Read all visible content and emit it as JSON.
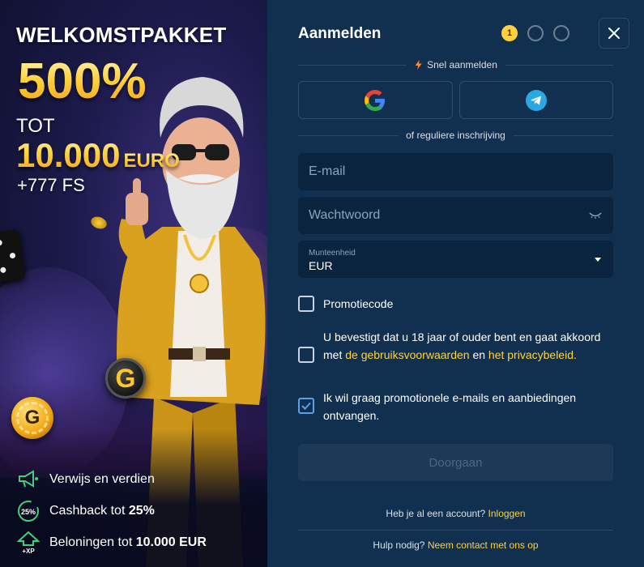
{
  "promo": {
    "title": "WELKOMSTPAKKET",
    "percent": "500%",
    "tot": "TOT",
    "amount": "10.000",
    "currency": "EURO",
    "free_spins": "+777 FS",
    "chip_letter": "G",
    "coin_letter": "G",
    "features": [
      {
        "icon": "megaphone-icon",
        "text": "Verwijs en verdien",
        "bold": ""
      },
      {
        "icon": "cashback-25-icon",
        "icon_text": "25%",
        "text": "Cashback tot ",
        "bold": "25%"
      },
      {
        "icon": "xp-arrow-icon",
        "icon_text": "+XP",
        "text": "Beloningen tot ",
        "bold": "10.000 EUR"
      }
    ]
  },
  "form": {
    "title": "Aanmelden",
    "step_active": "1",
    "quick_label": "Snel aanmelden",
    "or_label": "of reguliere inschrijving",
    "email_placeholder": "E-mail",
    "password_placeholder": "Wachtwoord",
    "currency_label": "Munteenheid",
    "currency_value": "EUR",
    "promo_code_label": "Promotiecode",
    "terms_text_1": "U bevestigt dat u 18 jaar of ouder bent en gaat akkoord met ",
    "terms_link_1": "de gebruiksvoorwaarden",
    "terms_text_2": " en ",
    "terms_link_2": "het privacybeleid.",
    "newsletter_label": "Ik wil graag promotionele e-mails en aanbiedingen ontvangen.",
    "submit_label": "Doorgaan",
    "have_account": "Heb je al een account?",
    "login_link": "Inloggen",
    "help_text": "Hulp nodig?",
    "contact_link": "Neem contact met ons op"
  },
  "colors": {
    "accent": "#ffd23d",
    "panel_bg": "#11304f",
    "field_bg": "#0a2440"
  }
}
